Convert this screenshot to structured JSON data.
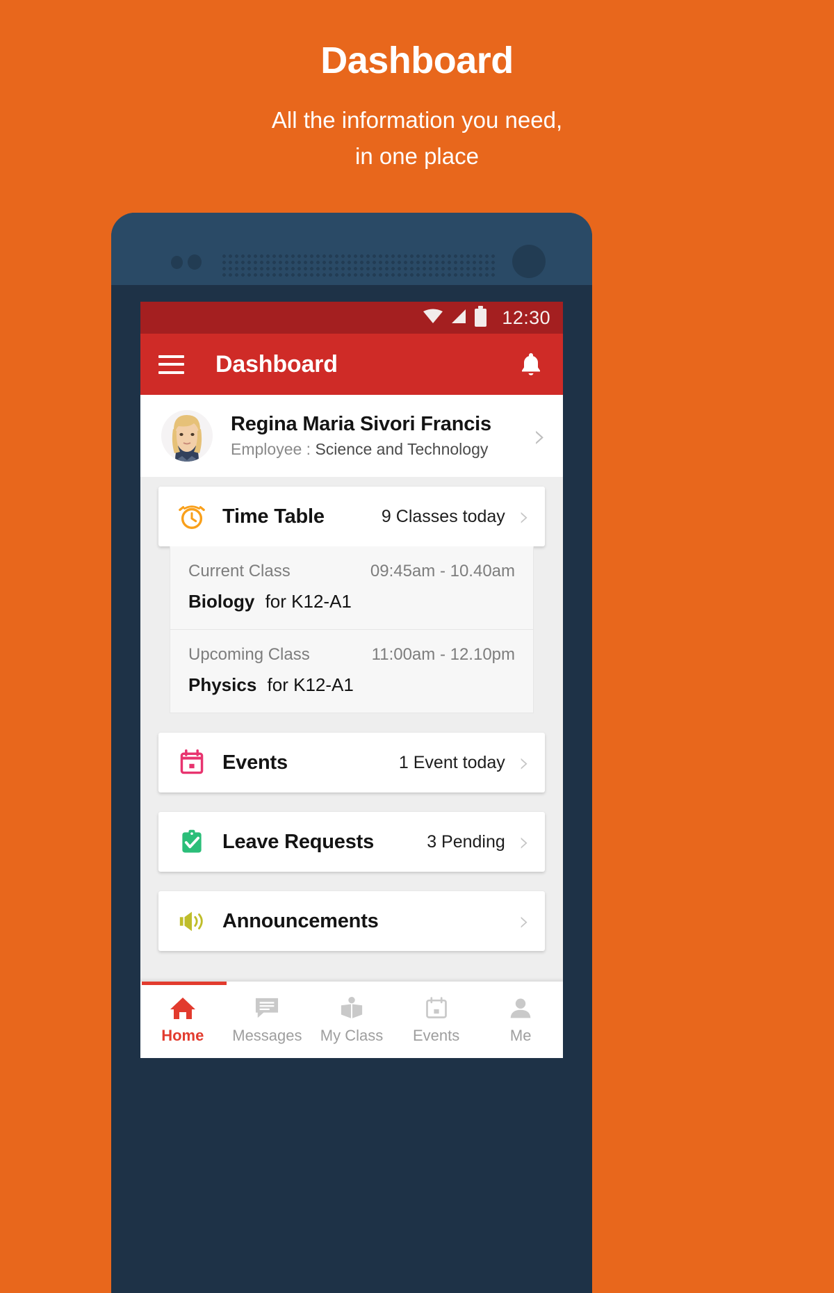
{
  "promo": {
    "title": "Dashboard",
    "subtitle_line1": "All the information you need,",
    "subtitle_line2": "in one place"
  },
  "colors": {
    "background": "#E8671C",
    "statusbar": "#A41F20",
    "appbar": "#CF2B27",
    "accent": "#E23B2E",
    "timetable_icon": "#F9A01B",
    "events_icon": "#E8346F",
    "leave_icon": "#2BBE79",
    "announcements_icon": "#BFBD2A"
  },
  "statusbar": {
    "time": "12:30",
    "icons": [
      "wifi-icon",
      "signal-icon",
      "battery-icon"
    ]
  },
  "appbar": {
    "menu_icon": "hamburger-icon",
    "title": "Dashboard",
    "notification_icon": "bell-icon"
  },
  "profile": {
    "name": "Regina Maria Sivori Francis",
    "role_label": "Employee :",
    "role_value": "Science and Technology",
    "chevron": "›"
  },
  "cards": [
    {
      "icon": "alarm-clock-icon",
      "title": "Time Table",
      "meta": "9 Classes today",
      "chevron": "›"
    },
    {
      "icon": "calendar-icon",
      "title": "Events",
      "meta": "1 Event today",
      "chevron": "›"
    },
    {
      "icon": "clipboard-check-icon",
      "title": "Leave Requests",
      "meta": "3 Pending",
      "chevron": "›"
    },
    {
      "icon": "megaphone-icon",
      "title": "Announcements",
      "meta": "",
      "chevron": "›"
    }
  ],
  "classes": [
    {
      "label": "Current Class",
      "time": "09:45am - 10.40am",
      "subject": "Biology",
      "section": "for K12-A1"
    },
    {
      "label": "Upcoming Class",
      "time": "11:00am - 12.10pm",
      "subject": "Physics",
      "section": "for K12-A1"
    }
  ],
  "bottom_nav": {
    "active_index": 0,
    "items": [
      {
        "icon": "home-icon",
        "label": "Home"
      },
      {
        "icon": "message-icon",
        "label": "Messages"
      },
      {
        "icon": "book-icon",
        "label": "My Class"
      },
      {
        "icon": "calendar-icon",
        "label": "Events"
      },
      {
        "icon": "person-icon",
        "label": "Me"
      }
    ]
  }
}
